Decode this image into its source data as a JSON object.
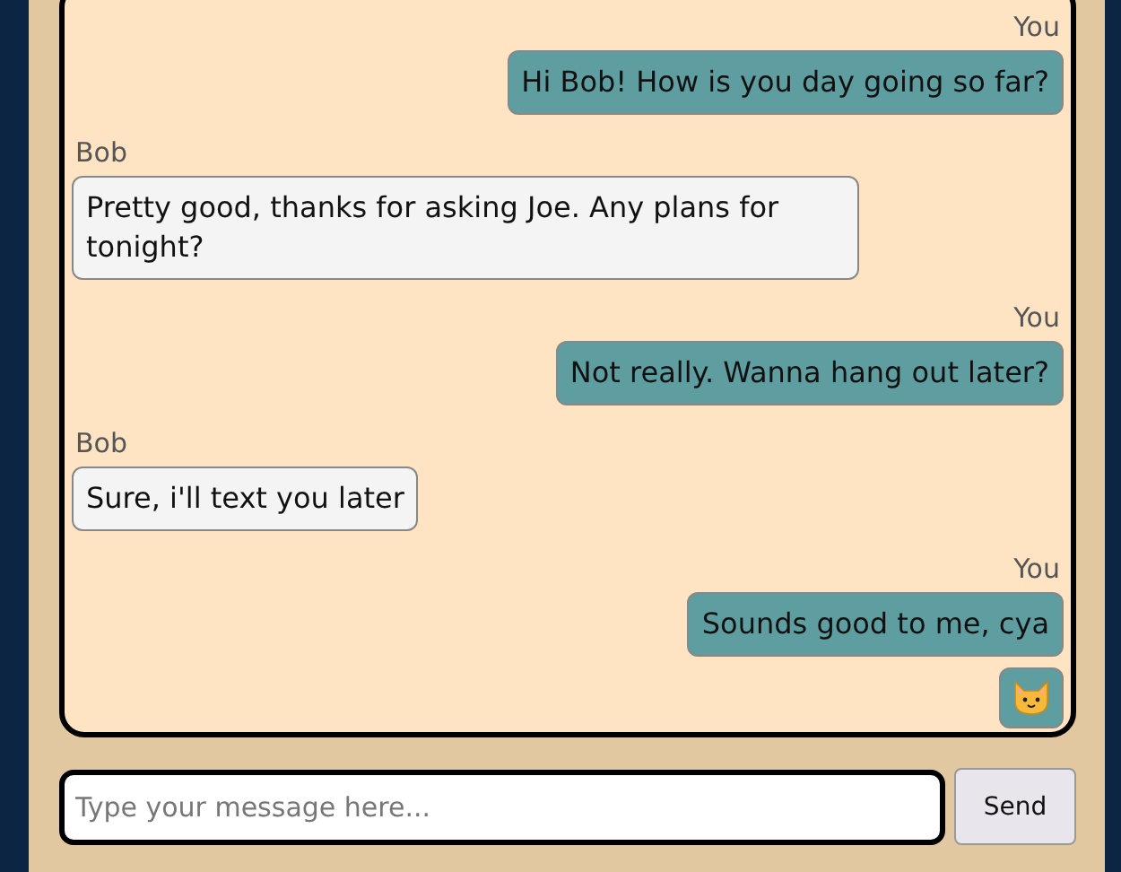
{
  "messages": [
    {
      "sender": "You",
      "mine": true,
      "kind": "text",
      "text": "Hi Bob! How is you day going so far?"
    },
    {
      "sender": "Bob",
      "mine": false,
      "kind": "text",
      "text": "Pretty good, thanks for asking Joe. Any plans for tonight?"
    },
    {
      "sender": "You",
      "mine": true,
      "kind": "text",
      "text": "Not really. Wanna hang out later?"
    },
    {
      "sender": "Bob",
      "mine": false,
      "kind": "text",
      "text": "Sure, i'll text you later"
    },
    {
      "sender": "You",
      "mine": true,
      "kind": "text",
      "text": "Sounds good to me, cya"
    },
    {
      "mine": true,
      "kind": "cat-emoji"
    }
  ],
  "composer": {
    "placeholder": "Type your message here...",
    "button": "Send"
  }
}
